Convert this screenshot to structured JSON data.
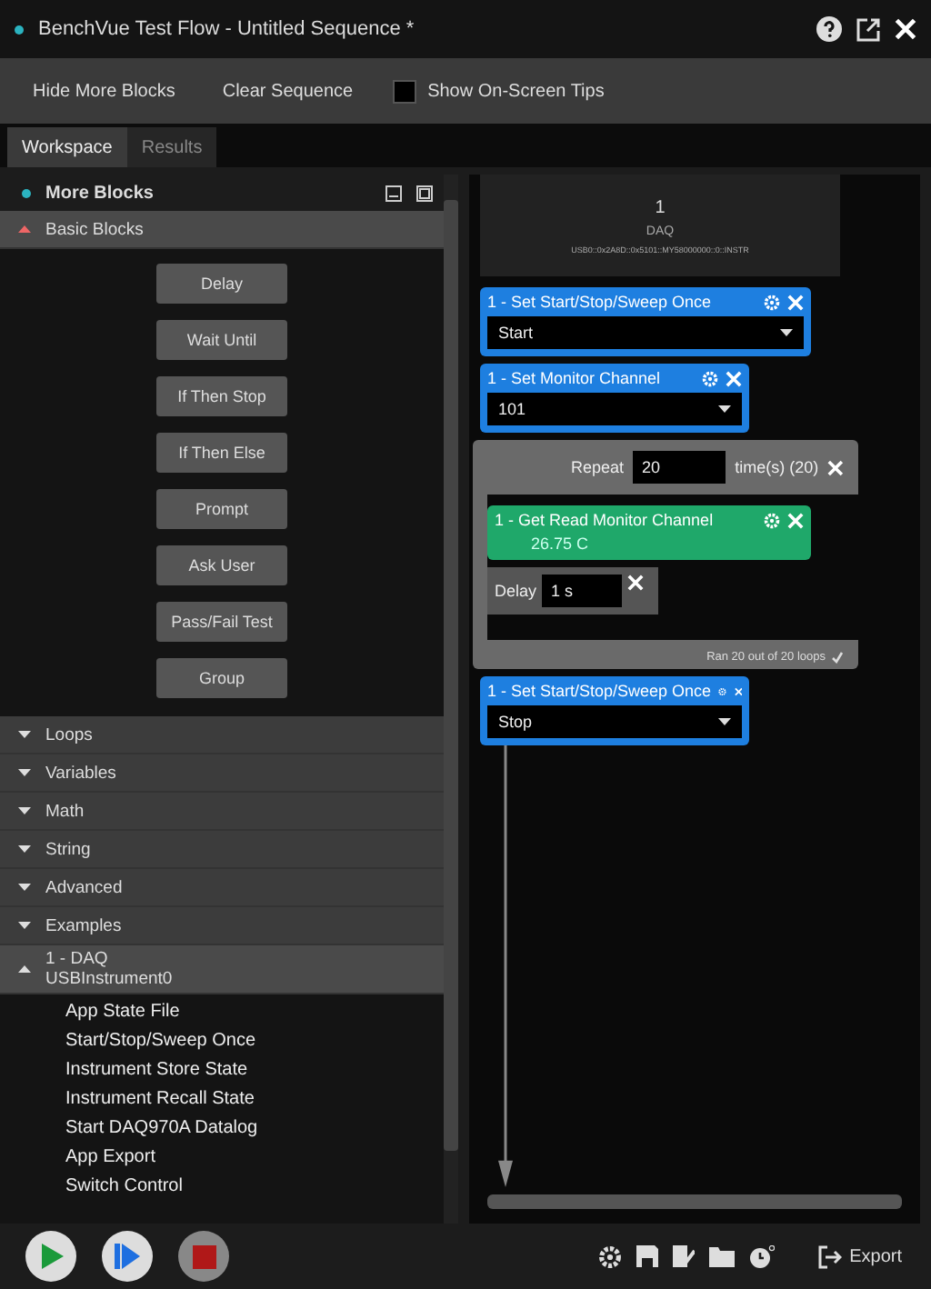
{
  "window": {
    "title": "BenchVue Test Flow - Untitled Sequence *"
  },
  "toolbar": {
    "buttons": [
      "Hide More Blocks",
      "Clear Sequence"
    ],
    "tips": {
      "label": "Show On-Screen Tips",
      "checked": false
    }
  },
  "tabs": [
    {
      "label": "Workspace",
      "selected": true
    },
    {
      "label": "Results",
      "selected": false
    }
  ],
  "palette": {
    "title": "More Blocks",
    "categories": [
      {
        "label": "Basic Blocks",
        "expanded": true,
        "blocks": [
          "Delay",
          "Wait Until",
          "If Then Stop",
          "If Then Else",
          "Prompt",
          "Ask User",
          "Pass/Fail Test",
          "Group"
        ]
      },
      {
        "label": "Loops",
        "expanded": false
      },
      {
        "label": "Variables",
        "expanded": false
      },
      {
        "label": "Math",
        "expanded": false
      },
      {
        "label": "String",
        "expanded": false
      },
      {
        "label": "Advanced",
        "expanded": false
      },
      {
        "label": "Examples",
        "expanded": false
      },
      {
        "label": "1 - DAQ USBInstrument0",
        "expanded": true,
        "items": [
          "App State File",
          "Start/Stop/Sweep Once",
          "Instrument Store State",
          "Instrument Recall State",
          "Start DAQ970A Datalog",
          "App Export",
          "Switch Control"
        ]
      }
    ]
  },
  "instrument": {
    "number": "1",
    "name": "DAQ",
    "address": "USB0::0x2A8D::0x5101::MY58000000::0::INSTR"
  },
  "sequence": [
    {
      "kind": "action",
      "title": "1 - Set Start/Stop/Sweep Once",
      "value": "Start"
    },
    {
      "kind": "action",
      "title": "1 - Set Monitor Channel",
      "value": "101"
    },
    {
      "kind": "loop",
      "label": "Repeat",
      "count": "20",
      "unit": "time(s) (20)",
      "footer": "Ran 20 out of 20 loops",
      "children": [
        {
          "kind": "reading",
          "title": "1 - Get Read Monitor Channel",
          "value": "26.75 C"
        },
        {
          "kind": "delay",
          "label": "Delay",
          "value": "1 s"
        }
      ]
    },
    {
      "kind": "action",
      "title": "1 - Set Start/Stop/Sweep Once",
      "value": "Stop"
    }
  ],
  "footer": {
    "export": "Export"
  }
}
